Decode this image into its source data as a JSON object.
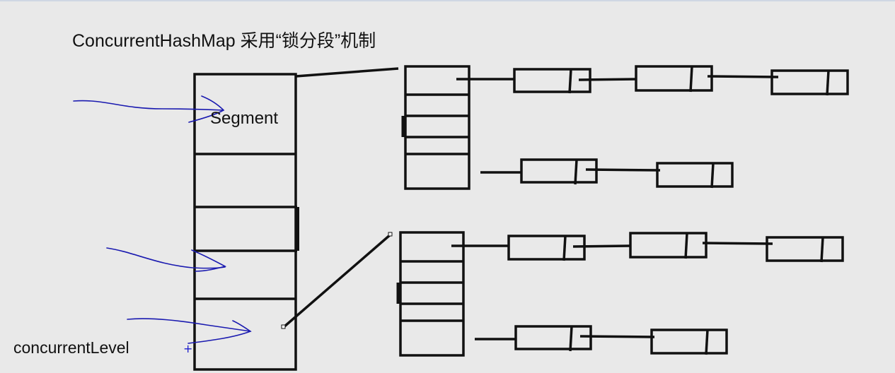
{
  "title": "ConcurrentHashMap  采用“锁分段”机制",
  "segment_label": "Segment",
  "level_label": "concurrentLevel",
  "plus_mark": "+",
  "colors": {
    "background": "#e9e9e9",
    "stroke": "#111111",
    "arrow": "#1a1ab0"
  }
}
